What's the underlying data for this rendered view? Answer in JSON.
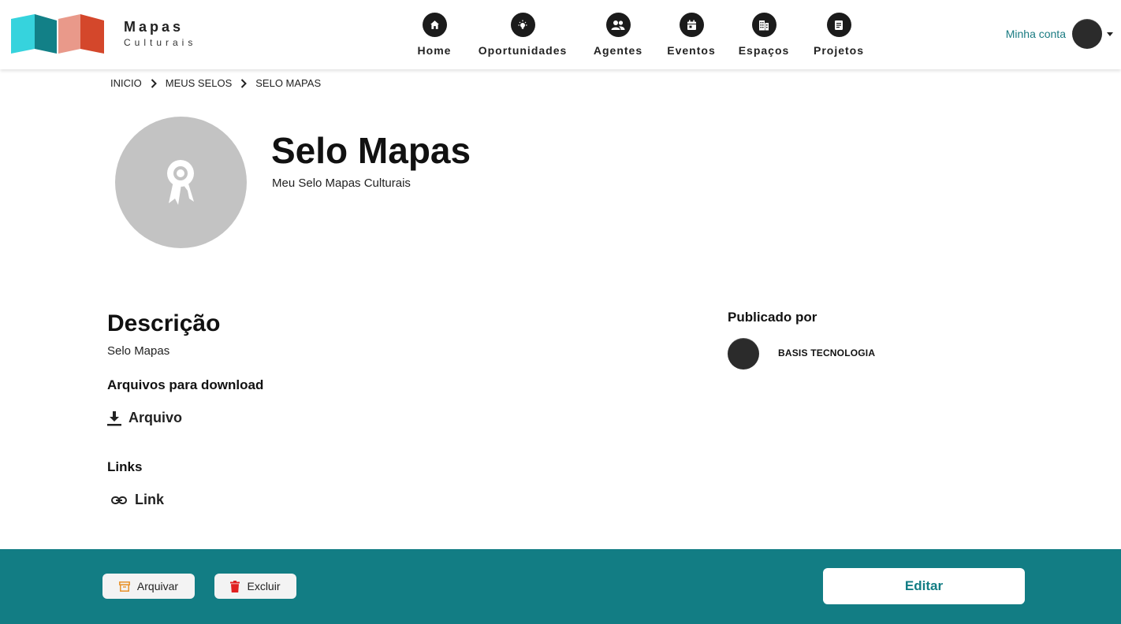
{
  "header": {
    "brand_name": "Mapas",
    "brand_sub": "Culturais",
    "nav": [
      {
        "label": "Home",
        "icon": "home-icon"
      },
      {
        "label": "Oportunidades",
        "icon": "lightbulb-icon"
      },
      {
        "label": "Agentes",
        "icon": "people-icon"
      },
      {
        "label": "Eventos",
        "icon": "calendar-icon"
      },
      {
        "label": "Espaços",
        "icon": "building-icon"
      },
      {
        "label": "Projetos",
        "icon": "document-icon"
      }
    ],
    "account_label": "Minha conta"
  },
  "breadcrumb": [
    "INICIO",
    "MEUS SELOS",
    "SELO MAPAS"
  ],
  "seal": {
    "title": "Selo Mapas",
    "subtitle": "Meu Selo Mapas Culturais"
  },
  "content": {
    "description_title": "Descrição",
    "description_text": "Selo Mapas",
    "files_title": "Arquivos para download",
    "file_label": "Arquivo",
    "links_title": "Links",
    "link_label": "Link"
  },
  "publisher": {
    "title": "Publicado por",
    "name": "BASIS TECNOLOGIA"
  },
  "footer": {
    "archive_label": "Arquivar",
    "delete_label": "Excluir",
    "edit_label": "Editar"
  },
  "colors": {
    "accent": "#127d84",
    "avatar_placeholder": "#c3c3c3",
    "logo_teal_light": "#36d3dd",
    "logo_teal_dark": "#128087",
    "logo_salmon": "#e9998a",
    "logo_red": "#d4472b",
    "archive_icon": "#e8922a",
    "delete_icon": "#e02020"
  }
}
